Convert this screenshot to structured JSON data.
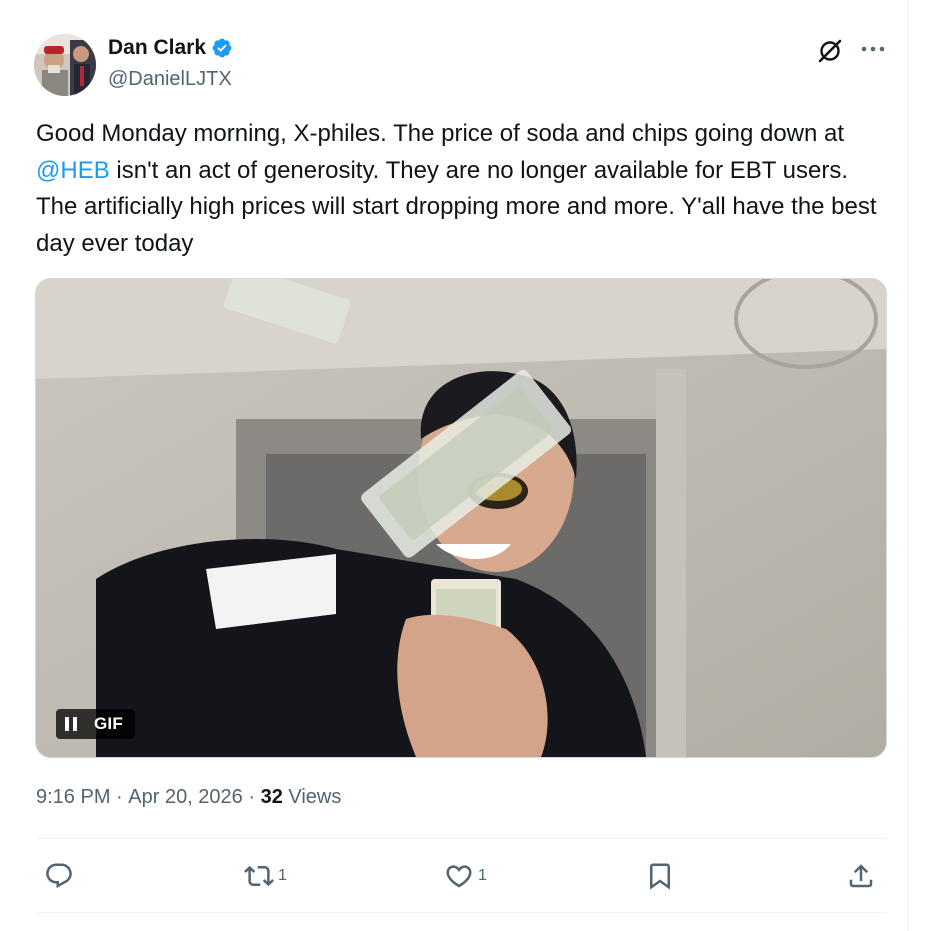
{
  "author": {
    "display_name": "Dan Clark",
    "handle": "@DanielLJTX",
    "verified": true
  },
  "tweet": {
    "text_parts": [
      "Good Monday morning, X-philes. The price of soda and chips going down at ",
      "@HEB",
      " isn't an act of generosity. They are no longer available for EBT users. The artificially high prices will start dropping more and more. Y'all have the best day ever today"
    ]
  },
  "media": {
    "gif_label": "GIF",
    "pause_icon": "pause-icon"
  },
  "meta": {
    "time": "9:16 PM",
    "sep1": " · ",
    "date": "Apr 20, 2026",
    "sep2": " · ",
    "views_count": "32",
    "views_label": " Views"
  },
  "actions": {
    "reply_count": "",
    "retweet_count": "1",
    "like_count": "1"
  },
  "colors": {
    "accent": "#1d9bf0",
    "text": "#0f1419",
    "muted": "#536471",
    "border": "#eff3f4"
  }
}
